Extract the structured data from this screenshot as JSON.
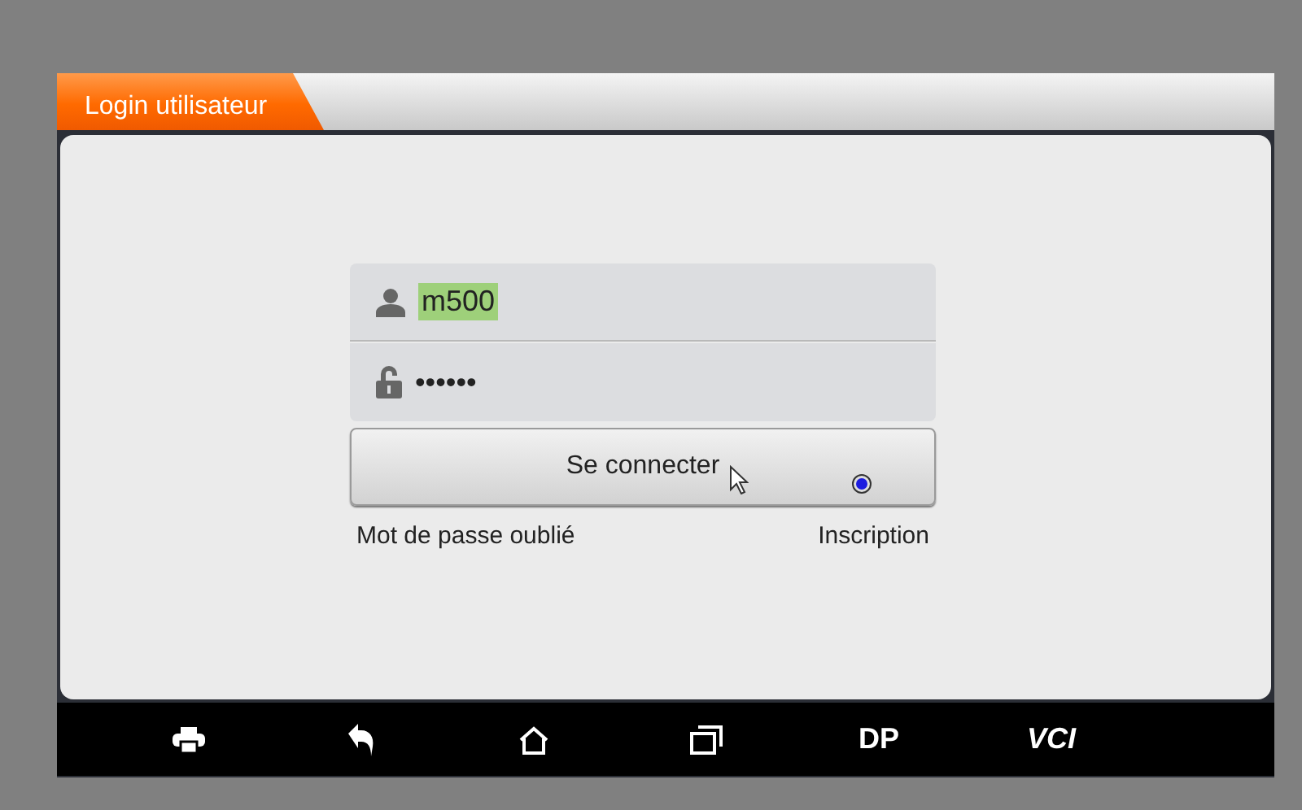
{
  "header": {
    "title": "Login utilisateur"
  },
  "login": {
    "username": {
      "value": "m500",
      "highlighted": true
    },
    "password": {
      "value": "••••••"
    },
    "submit": "Se connecter",
    "links": [
      "Mot de passe oublié",
      "Inscription"
    ]
  },
  "nav_bar": {
    "items": [
      {
        "kind": "printer"
      },
      {
        "kind": "back"
      },
      {
        "kind": "home"
      },
      {
        "kind": "recent"
      },
      {
        "kind": "text",
        "label": "DP",
        "italic": false
      },
      {
        "kind": "text",
        "label": "VCI",
        "italic": true
      }
    ]
  }
}
